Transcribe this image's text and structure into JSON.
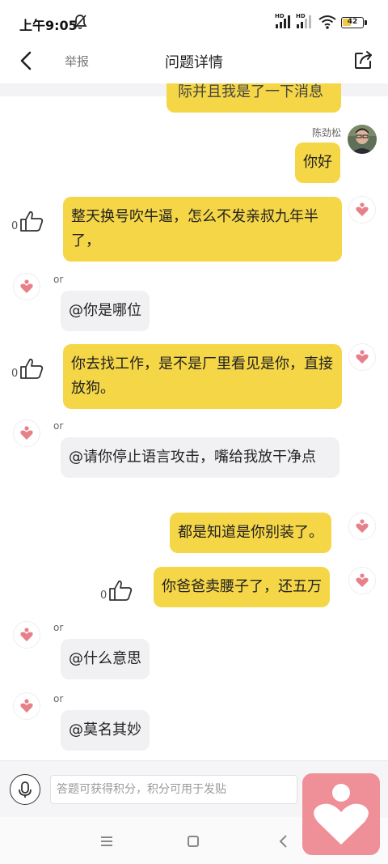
{
  "status": {
    "time": "上午9:05",
    "signal1": "HD",
    "signal2": "HD",
    "battery": "42",
    "battery_level": 0.42
  },
  "header": {
    "report": "举报",
    "title": "问题详情"
  },
  "users": {
    "me": "陈劲松",
    "other": "or"
  },
  "messages": {
    "partial": "际并且我是了一下消息",
    "m1": "你好",
    "m2": "整天换号吹牛逼，怎么不发亲叔九年半了，",
    "m2_likes": "0",
    "m3": "@你是哪位",
    "m4": "你去找工作，是不是厂里看见是你，直接放狗。",
    "m4_likes": "0",
    "m5": "@请你停止语言攻击，嘴给我放干净点",
    "m6": "都是知道是你别装了。",
    "m7": "你爸爸卖腰子了，还五万",
    "m7_likes": "0",
    "m8": "@什么意思",
    "m9": "@莫名其妙"
  },
  "input": {
    "placeholder": "答题可获得积分，积分可用于发贴"
  },
  "colors": {
    "bubble_yellow": "#f5d646",
    "bubble_gray": "#f1f1f4",
    "heart_pink": "#e8808a",
    "fab_pink": "#ef8f98"
  },
  "icons": [
    "bell-off-icon",
    "wifi-icon",
    "back-icon",
    "share-icon",
    "thumb-up-icon",
    "heart-icon",
    "mic-icon",
    "menu-icon",
    "home-icon",
    "nav-back-icon"
  ]
}
